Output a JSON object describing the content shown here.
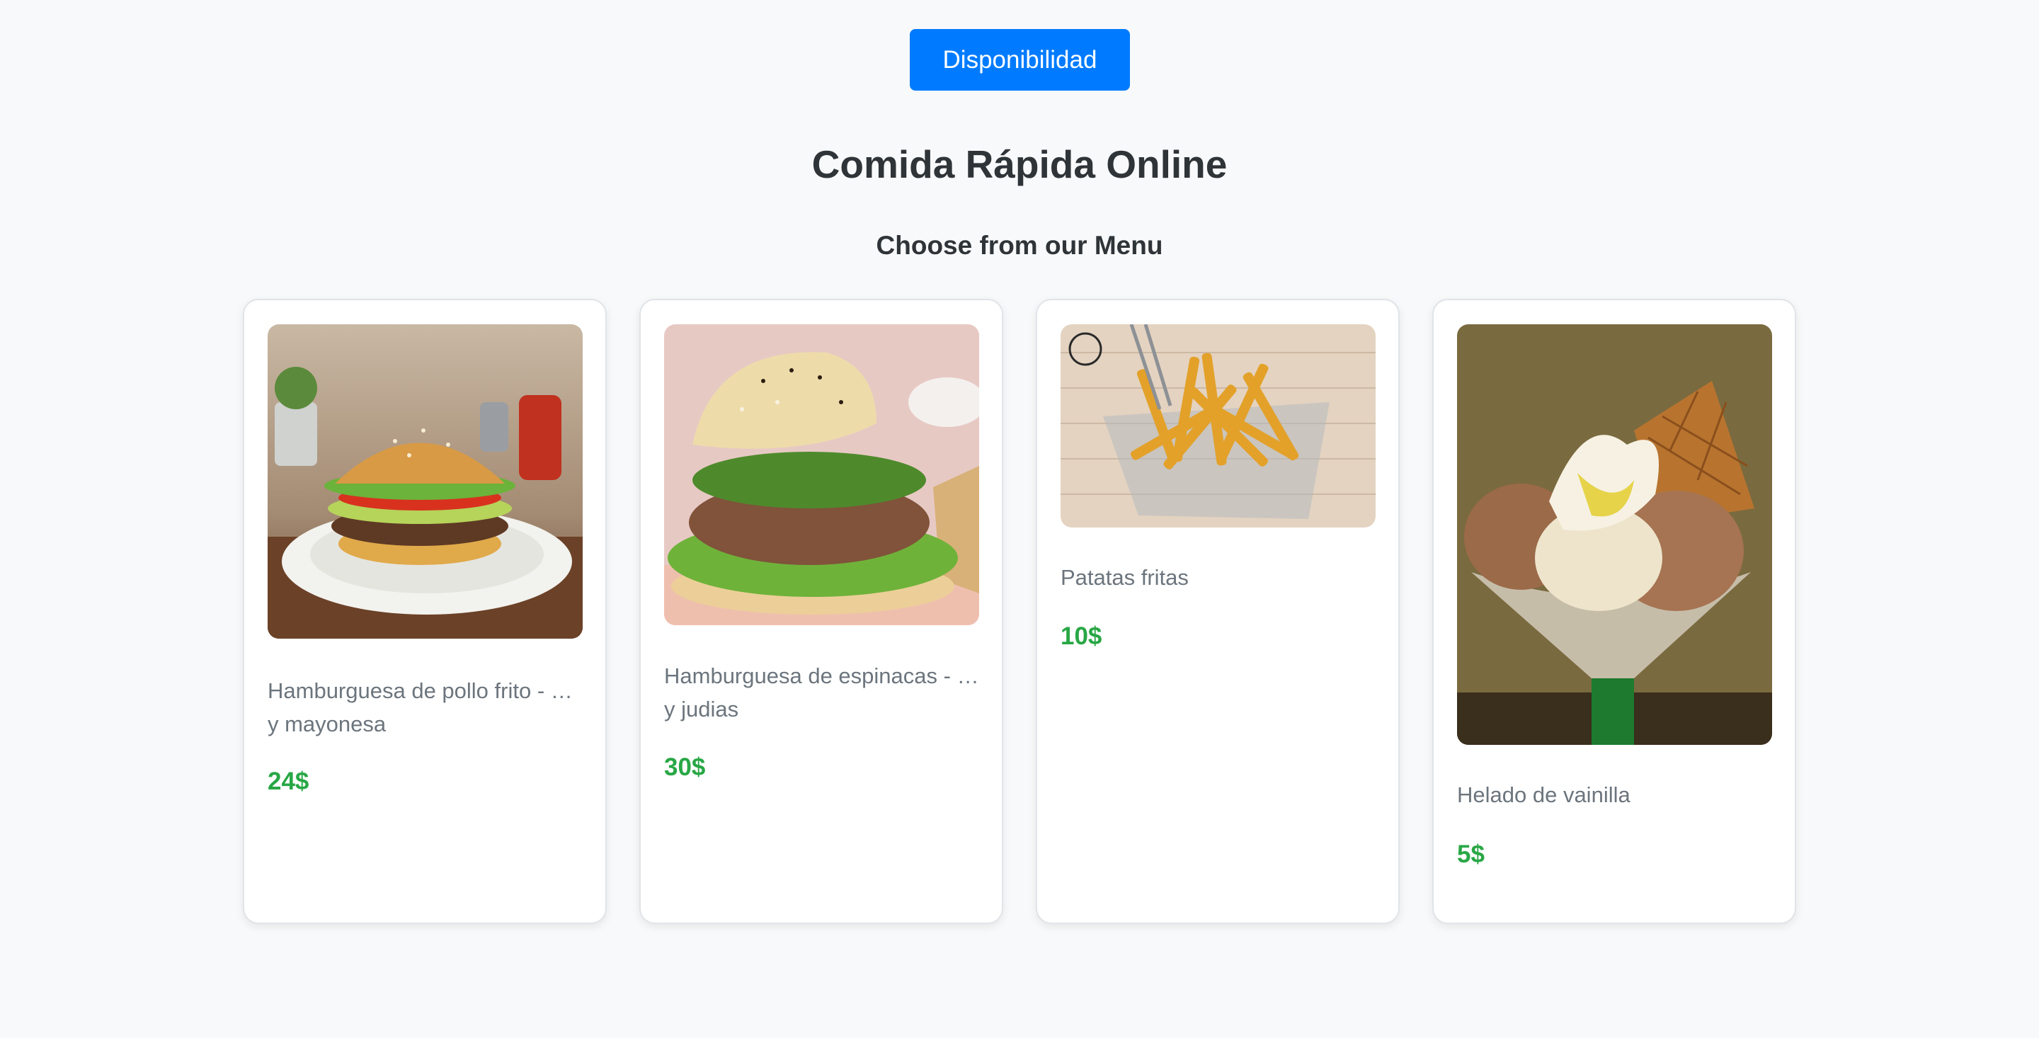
{
  "header": {
    "availability_button": "Disponibilidad",
    "title": "Comida Rápida Online",
    "subtitle": "Choose from our Menu"
  },
  "menu": {
    "items": [
      {
        "name": "Hamburguesa de pollo frito - … y mayonesa",
        "price": "24$"
      },
      {
        "name": "Hamburguesa de espinacas - … y judias",
        "price": "30$"
      },
      {
        "name": "Patatas fritas",
        "price": "10$"
      },
      {
        "name": "Helado de vainilla",
        "price": "5$"
      }
    ]
  },
  "colors": {
    "accent": "#007bff",
    "price": "#28a745",
    "background": "#f8f9fa"
  }
}
